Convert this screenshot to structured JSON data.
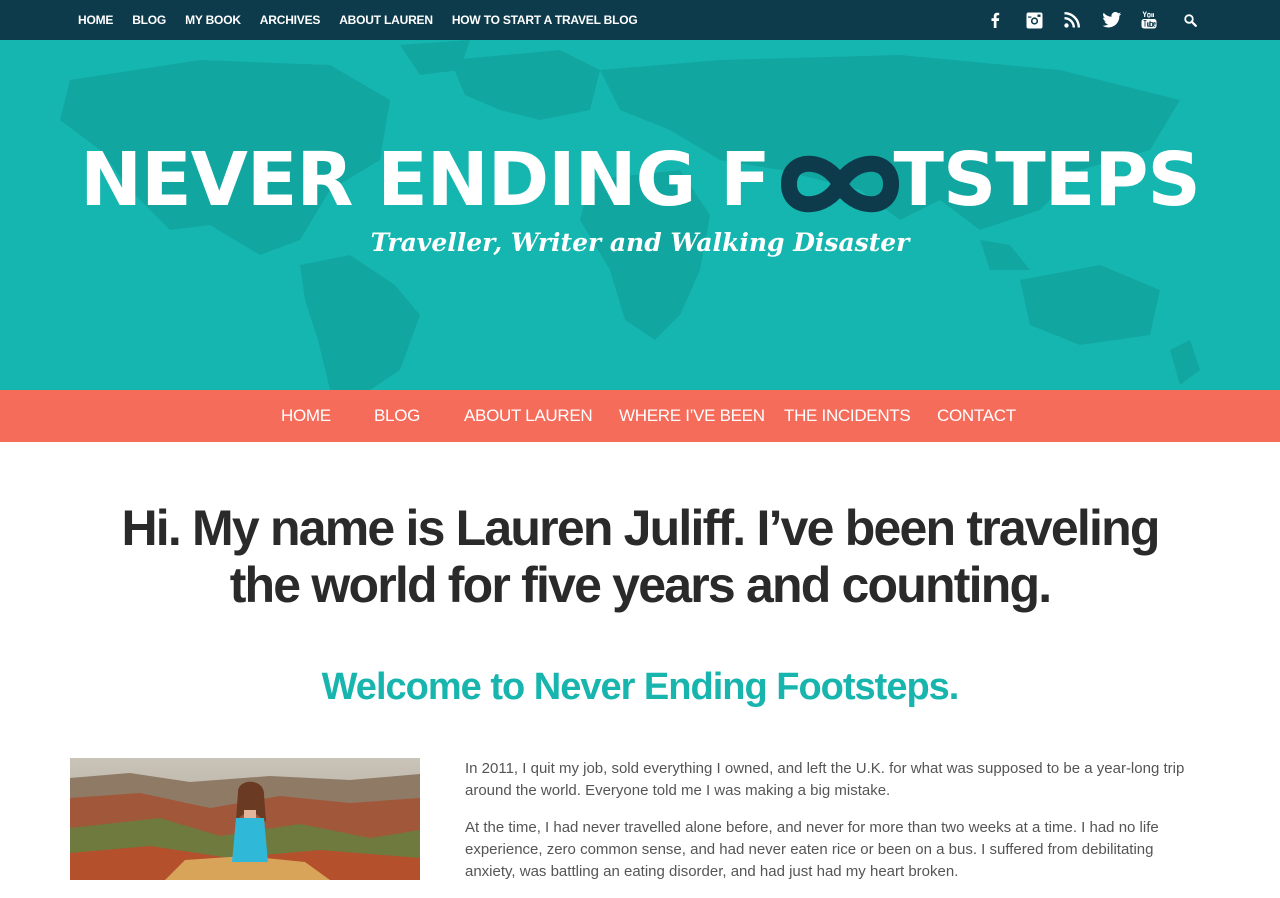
{
  "topbar": {
    "nav": [
      {
        "label": "HOME"
      },
      {
        "label": "BLOG"
      },
      {
        "label": "MY BOOK"
      },
      {
        "label": "ARCHIVES"
      },
      {
        "label": "ABOUT LAUREN"
      },
      {
        "label": "HOW TO START A TRAVEL BLOG"
      }
    ],
    "social_icons": [
      "facebook-icon",
      "instagram-icon",
      "rss-icon",
      "twitter-icon",
      "youtube-icon",
      "search-icon"
    ]
  },
  "hero": {
    "title_before": "NEVER ENDING F",
    "title_oo": "OO",
    "title_after": "TSTEPS",
    "tagline": "Traveller, Writer and Walking Disaster",
    "colors": {
      "background": "#16b6b0",
      "map": "#12a9a3",
      "infinity": "#0d3b4c"
    }
  },
  "mainnav": {
    "items": [
      {
        "label": "HOME"
      },
      {
        "label": "BLOG"
      },
      {
        "label": "ABOUT LAUREN"
      },
      {
        "label": "WHERE I’VE BEEN"
      },
      {
        "label": "THE INCIDENTS"
      },
      {
        "label": "CONTACT"
      }
    ],
    "color": "#f66c5b"
  },
  "content": {
    "headline": "Hi. My name is Lauren Juliff. I’ve been traveling the world for five years and counting.",
    "welcome": "Welcome to Never Ending Footsteps.",
    "paragraphs": [
      "In 2011, I quit my job, sold everything I owned, and left the U.K. for what was supposed to be a year-long trip around the world. Everyone told me I was making a big mistake.",
      "At the time, I had never travelled alone before, and never for more than two weeks at a time. I had no life experience, zero common sense, and had never eaten rice or been on a bus. I suffered from debilitating anxiety, was battling an eating disorder, and had just had my heart broken."
    ],
    "accent_color": "#17b5ad"
  }
}
